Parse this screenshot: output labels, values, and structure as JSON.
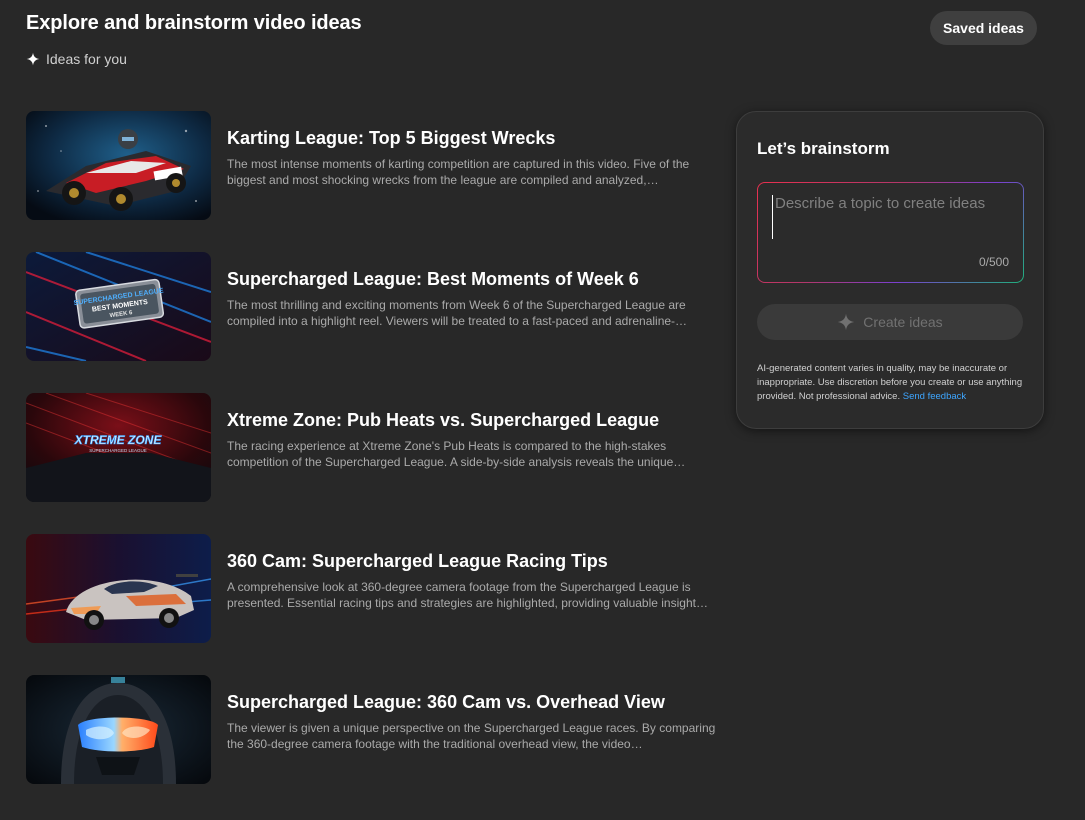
{
  "header": {
    "title": "Explore and brainstorm video ideas",
    "saved_label": "Saved ideas",
    "subtitle": "Ideas for you"
  },
  "ideas": [
    {
      "title": "Karting League: Top 5 Biggest Wrecks",
      "description": "The most intense moments of karting competition are captured in this video. Five of the biggest and most shocking wrecks from the league are compiled and analyzed,…",
      "thumbnail_icon": "go-kart-thumbnail"
    },
    {
      "title": "Supercharged League: Best Moments of Week 6",
      "description": "The most thrilling and exciting moments from Week 6 of the Supercharged League are compiled into a highlight reel. Viewers will be treated to a fast-paced and adrenaline-…",
      "thumbnail_icon": "league-badge-thumbnail",
      "thumbnail_text": [
        "SUPERCHARGED LEAGUE",
        "BEST MOMENTS",
        "WEEK 6"
      ]
    },
    {
      "title": "Xtreme Zone: Pub Heats vs. Supercharged League",
      "description": "The racing experience at Xtreme Zone's Pub Heats is compared to the high-stakes competition of the Supercharged League. A side-by-side analysis reveals the unique…",
      "thumbnail_icon": "xtreme-zone-logo-thumbnail",
      "thumbnail_text": [
        "XTREME ZONE",
        "SUPERCHARGED LEAGUE"
      ]
    },
    {
      "title": "360 Cam: Supercharged League Racing Tips",
      "description": "A comprehensive look at 360-degree camera footage from the Supercharged League is presented. Essential racing tips and strategies are highlighted, providing valuable insight…",
      "thumbnail_icon": "race-car-thumbnail"
    },
    {
      "title": "Supercharged League: 360 Cam vs. Overhead View",
      "description": "The viewer is given a unique perspective on the Supercharged League races. By comparing the 360-degree camera footage with the traditional overhead view, the video…",
      "thumbnail_icon": "racing-helmet-thumbnail"
    }
  ],
  "brainstorm": {
    "title": "Let’s brainstorm",
    "input_placeholder": "Describe a topic to create ideas",
    "input_value": "",
    "char_count": "0/500",
    "create_label": "Create ideas",
    "disclaimer": "AI-generated content varies in quality, may be inaccurate or inappropriate. Use discretion before you create or use anything provided. Not professional advice.",
    "feedback_link": "Send feedback"
  },
  "colors": {
    "background": "#282828",
    "accent_link": "#3ea6ff",
    "button_bg": "#3f3f3f"
  }
}
